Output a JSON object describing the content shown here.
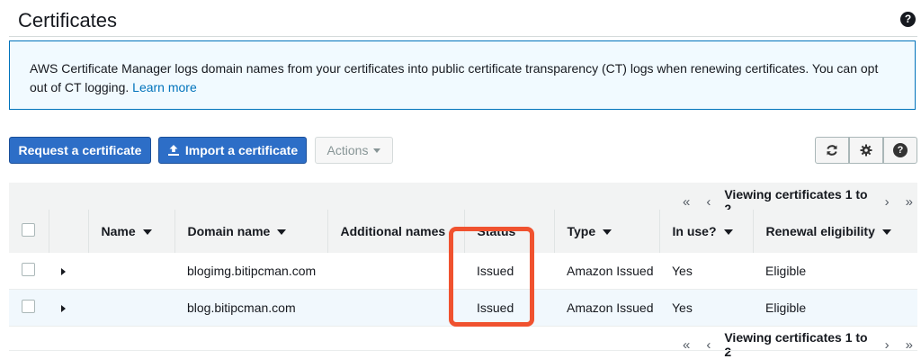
{
  "header": {
    "title": "Certificates",
    "help_icon": "help-circle-icon"
  },
  "info": {
    "text": "AWS Certificate Manager logs domain names from your certificates into public certificate transparency (CT) logs when renewing certificates. You can opt out of CT logging.",
    "link": "Learn more"
  },
  "toolbar": {
    "request_label": "Request a certificate",
    "import_label": "Import a certificate",
    "actions_label": "Actions",
    "refresh_icon": "refresh-icon",
    "settings_icon": "gear-icon",
    "help_icon": "help-circle-icon"
  },
  "pager": {
    "first": "«",
    "prev": "‹",
    "text": "Viewing certificates 1 to 2",
    "next": "›",
    "last": "»"
  },
  "table": {
    "columns": [
      "",
      "",
      "Name",
      "Domain name",
      "Additional names",
      "Status",
      "Type",
      "In use?",
      "Renewal eligibility"
    ],
    "rows": [
      {
        "name": "",
        "domain": "blogimg.bitipcman.com",
        "additional": "",
        "status": "Issued",
        "type": "Amazon Issued",
        "in_use": "Yes",
        "renewal": "Eligible"
      },
      {
        "name": "",
        "domain": "blog.bitipcman.com",
        "additional": "",
        "status": "Issued",
        "type": "Amazon Issued",
        "in_use": "Yes",
        "renewal": "Eligible"
      }
    ]
  },
  "colors": {
    "primary": "#2d6ec7",
    "link": "#0073bb",
    "issued": "#1d8102",
    "highlight": "#f0522f"
  }
}
